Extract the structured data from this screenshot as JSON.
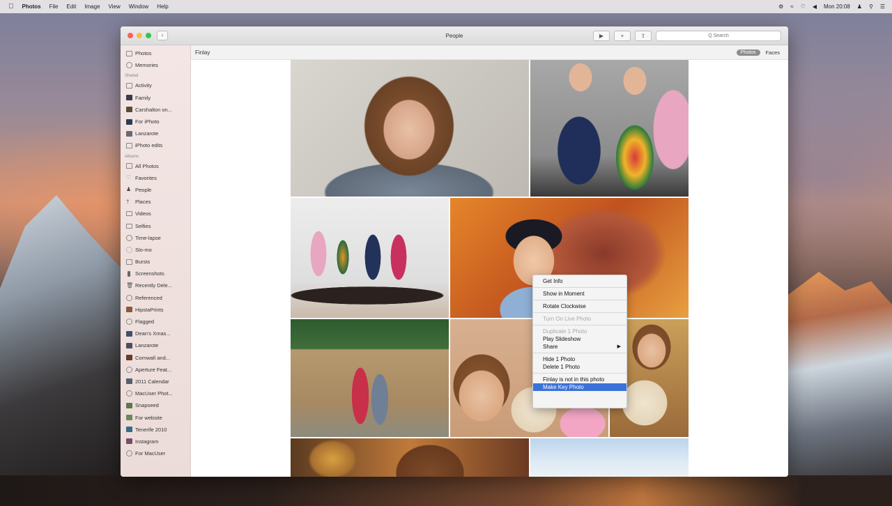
{
  "menubar": {
    "app": "Photos",
    "items": [
      "File",
      "Edit",
      "Image",
      "View",
      "Window",
      "Help"
    ],
    "clock": "Mon 20:08"
  },
  "window": {
    "title": "People",
    "search_placeholder": "Q Search",
    "back_glyph": "‹",
    "breadcrumb": "Finlay",
    "segment": {
      "photos": "Photos",
      "faces": "Faces"
    }
  },
  "sidebar": {
    "top": [
      {
        "label": "Photos",
        "icon": "photos-icon"
      },
      {
        "label": "Memories",
        "icon": "memories-icon"
      }
    ],
    "shared_head": "Shared",
    "shared": [
      {
        "label": "Activity",
        "icon": "activity-icon"
      },
      {
        "label": "Family",
        "icon": "album-thumb-icon"
      },
      {
        "label": "Carshalton on...",
        "icon": "album-thumb-icon"
      },
      {
        "label": "For iPhoto",
        "icon": "album-thumb-icon"
      },
      {
        "label": "Lanzarote",
        "icon": "album-thumb-icon"
      },
      {
        "label": "iPhoto edits",
        "icon": "album-icon"
      }
    ],
    "albums_head": "Albums",
    "albums": [
      {
        "label": "All Photos",
        "icon": "album-icon"
      },
      {
        "label": "Favorites",
        "icon": "heart-icon"
      },
      {
        "label": "People",
        "icon": "person-icon"
      },
      {
        "label": "Places",
        "icon": "pin-icon"
      },
      {
        "label": "Videos",
        "icon": "video-icon"
      },
      {
        "label": "Selfies",
        "icon": "selfie-icon"
      },
      {
        "label": "Time-lapse",
        "icon": "timelapse-icon"
      },
      {
        "label": "Slo-mo",
        "icon": "slomo-icon"
      },
      {
        "label": "Bursts",
        "icon": "bursts-icon"
      },
      {
        "label": "Screenshots",
        "icon": "screenshot-icon"
      },
      {
        "label": "Recently Dele...",
        "icon": "trash-icon"
      },
      {
        "label": "Referenced",
        "icon": "referenced-icon"
      },
      {
        "label": "HipstaPrints",
        "icon": "album-thumb-icon"
      },
      {
        "label": "Flagged",
        "icon": "flag-icon"
      },
      {
        "label": "Dean's Xmas...",
        "icon": "album-thumb-icon"
      },
      {
        "label": "Lanzarote",
        "icon": "album-thumb-icon"
      },
      {
        "label": "Cornwall and...",
        "icon": "album-thumb-icon"
      },
      {
        "label": "Aperture Feat...",
        "icon": "album-icon"
      },
      {
        "label": "2011 Calendar",
        "icon": "album-thumb-icon"
      },
      {
        "label": "MacUser Phot...",
        "icon": "album-icon"
      },
      {
        "label": "Snapseed",
        "icon": "album-thumb-icon"
      },
      {
        "label": "For website",
        "icon": "album-thumb-icon"
      },
      {
        "label": "Tenerife 2010",
        "icon": "album-thumb-icon"
      },
      {
        "label": "Instagram",
        "icon": "album-thumb-icon"
      },
      {
        "label": "For MacUser",
        "icon": "album-icon"
      }
    ]
  },
  "context_menu": {
    "items": [
      {
        "label": "Get Info",
        "state": "normal"
      },
      {
        "label": "Show in Moment",
        "state": "normal"
      },
      {
        "label": "Rotate Clockwise",
        "state": "normal"
      },
      {
        "label": "Turn On Live Photo",
        "state": "disabled"
      },
      {
        "label": "Duplicate 1 Photo",
        "state": "disabled"
      },
      {
        "label": "Play Slideshow",
        "state": "normal"
      },
      {
        "label": "Share",
        "state": "normal"
      },
      {
        "label": "Hide 1 Photo",
        "state": "normal"
      },
      {
        "label": "Delete 1 Photo",
        "state": "normal"
      },
      {
        "label": "Finlay is not in this photo",
        "state": "normal"
      },
      {
        "label": "Make Key Photo",
        "state": "highlighted"
      }
    ],
    "share_arrow": "▶"
  },
  "colors": {
    "accent": "#3b72d9",
    "selection": "#5b8ed6",
    "close": "#fc605c",
    "minimize": "#fdbc40",
    "zoom": "#34c84a"
  }
}
